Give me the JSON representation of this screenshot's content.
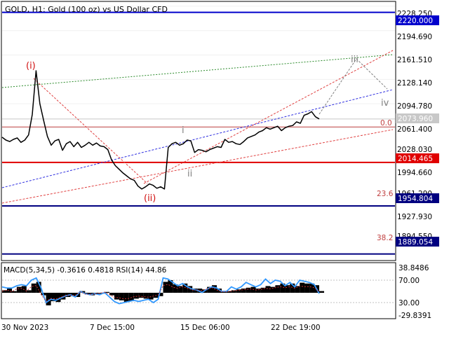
{
  "symbol_header": "GOLD, H1:  Gold (100 oz) vs US Dollar CFD",
  "colors": {
    "background": "#ffffff",
    "price_line": "#000000",
    "resistance": "#0000cc",
    "support": "#e00000",
    "fib_level": "#000080",
    "fib_zero": "#c04040",
    "wave_red": "#d01010",
    "wave_gray": "#808080",
    "trend_blue": "#3030e0",
    "trend_red": "#e04040",
    "trend_green": "#2a8a2a",
    "macd_line": "#3399ff",
    "rsi_line": "#cc3333"
  },
  "price_axis": {
    "ticks": [
      "2228.250",
      "2194.690",
      "2161.510",
      "2128.140",
      "2094.780",
      "2061.400",
      "2028.030",
      "1994.660",
      "1961.290",
      "1927.930",
      "1894.550"
    ],
    "ylim": [
      1880,
      2235
    ]
  },
  "level_labels": [
    {
      "name": "level-2220",
      "value": 2220.0,
      "label": "2220.000",
      "color": "#0000cc"
    },
    {
      "name": "level-current",
      "value": 2073.96,
      "label": "2073.960",
      "color": "#c0c0c0"
    },
    {
      "name": "level-2014",
      "value": 2014.465,
      "label": "2014.465",
      "color": "#e00000"
    },
    {
      "name": "level-1954",
      "value": 1954.804,
      "label": "1954.804",
      "color": "#000080"
    },
    {
      "name": "level-1889",
      "value": 1889.054,
      "label": "1889.054",
      "color": "#000080"
    }
  ],
  "fib_labels": [
    {
      "name": "fib-0-label",
      "text": "0.0",
      "value": 2063.0
    },
    {
      "name": "fib-236-label",
      "text": "23.6",
      "value": 1958.0
    },
    {
      "name": "fib-382-label",
      "text": "38.2",
      "value": 1892.0
    }
  ],
  "wave_labels": [
    {
      "name": "wave-i-label",
      "text": "(i)",
      "color": "#d01010"
    },
    {
      "name": "wave-ii-label",
      "text": "(ii)",
      "color": "#d01010"
    },
    {
      "name": "wave-small-i-label",
      "text": "i",
      "color": "#808080"
    },
    {
      "name": "wave-small-ii-label",
      "text": "ii",
      "color": "#808080"
    },
    {
      "name": "wave-iii-label",
      "text": "iii",
      "color": "#808080"
    },
    {
      "name": "wave-iv-label",
      "text": "iv",
      "color": "#808080"
    }
  ],
  "indicator": {
    "header": "MACD(5,34,5) -0.3616 0.4818 RSI(14) 44.86",
    "ticks": [
      "38.8486",
      "70.00",
      "30.00",
      "-29.8391"
    ]
  },
  "time_axis": {
    "labels": [
      "30 Nov 2023",
      "7 Dec 15:00",
      "15 Dec 06:00",
      "22 Dec 19:00"
    ]
  },
  "chart_data": {
    "type": "line",
    "title": "GOLD, H1:  Gold (100 oz) vs US Dollar CFD",
    "ylim": [
      1880,
      2235
    ],
    "price_series": {
      "name": "",
      "values": [
        2049,
        2045,
        2043,
        2046,
        2048,
        2042,
        2045,
        2052,
        2080,
        2140,
        2095,
        2072,
        2050,
        2038,
        2044,
        2046,
        2031,
        2040,
        2043,
        2036,
        2042,
        2035,
        2038,
        2042,
        2038,
        2041,
        2037,
        2036,
        2032,
        2018,
        2010,
        2005,
        2000,
        1996,
        1992,
        1990,
        1982,
        1978,
        1981,
        1985,
        1983,
        1979,
        1981,
        1978,
        2035,
        2040,
        2042,
        2038,
        2040,
        2045,
        2044,
        2028,
        2032,
        2031,
        2029,
        2032,
        2034,
        2036,
        2035,
        2046,
        2042,
        2043,
        2040,
        2039,
        2043,
        2048,
        2050,
        2052,
        2056,
        2058,
        2062,
        2060,
        2062,
        2064,
        2058,
        2062,
        2064,
        2065,
        2070,
        2068,
        2079,
        2081,
        2084,
        2077,
        2074
      ]
    },
    "macd_histogram": [
      6,
      10,
      4,
      14,
      16,
      6,
      22,
      26,
      -6,
      -30,
      -20,
      -22,
      -16,
      -10,
      -8,
      -10,
      4,
      -4,
      -6,
      -4,
      -2,
      2,
      -6,
      -16,
      -18,
      -22,
      -20,
      -14,
      -12,
      -14,
      -16,
      -12,
      -8,
      26,
      30,
      20,
      16,
      22,
      16,
      10,
      10,
      8,
      14,
      18,
      10,
      4,
      4,
      6,
      8,
      10,
      12,
      14,
      10,
      12,
      16,
      14,
      18,
      22,
      18,
      22,
      16,
      24,
      22,
      22,
      18,
      4
    ],
    "rsi_series": [
      58,
      56,
      56,
      60,
      62,
      60,
      70,
      74,
      56,
      30,
      36,
      34,
      38,
      42,
      44,
      40,
      50,
      46,
      44,
      46,
      44,
      48,
      40,
      32,
      28,
      30,
      32,
      34,
      32,
      34,
      36,
      30,
      36,
      74,
      72,
      66,
      60,
      64,
      58,
      54,
      52,
      48,
      54,
      58,
      56,
      50,
      50,
      58,
      54,
      58,
      66,
      62,
      58,
      62,
      72,
      64,
      70,
      68,
      60,
      66,
      58,
      70,
      68,
      66,
      62,
      46
    ],
    "support_levels": [
      2014.465,
      1954.804,
      1889.054
    ],
    "resistance_levels": [
      2220.0
    ]
  }
}
